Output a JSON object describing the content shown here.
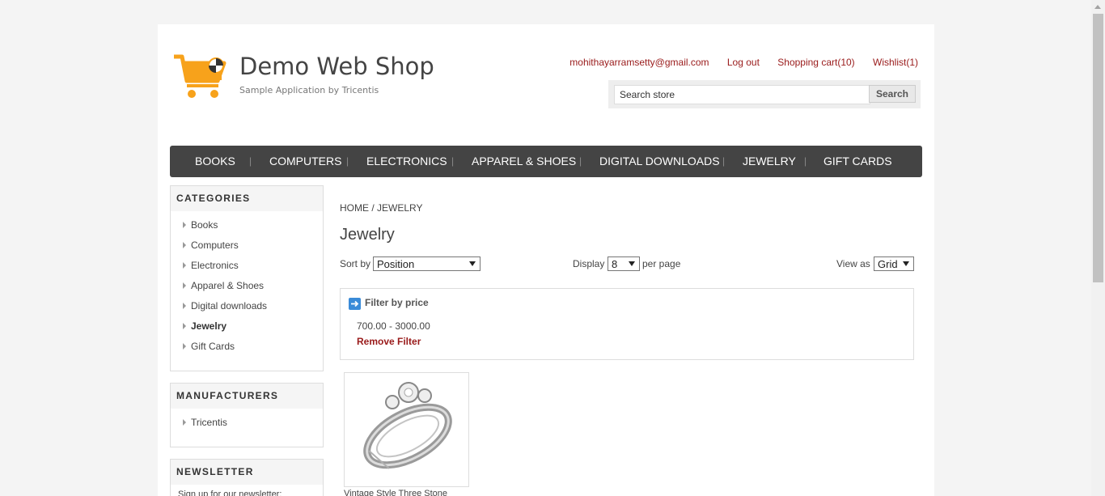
{
  "site": {
    "title": "Demo Web Shop",
    "subtitle": "Sample Application by Tricentis",
    "brand_color": "#f7a21b"
  },
  "header_links": {
    "account": "mohithayarramsetty@gmail.com",
    "logout": "Log out",
    "cart": "Shopping cart(10)",
    "wishlist": "Wishlist(1)"
  },
  "search": {
    "value": "Search store",
    "button": "Search"
  },
  "top_menu": [
    "BOOKS",
    "COMPUTERS",
    "ELECTRONICS",
    "APPAREL & SHOES",
    "DIGITAL DOWNLOADS",
    "JEWELRY",
    "GIFT CARDS"
  ],
  "categories": {
    "title": "CATEGORIES",
    "items": [
      "Books",
      "Computers",
      "Electronics",
      "Apparel & Shoes",
      "Digital downloads",
      "Jewelry",
      "Gift Cards"
    ],
    "active": "Jewelry"
  },
  "manufacturers": {
    "title": "MANUFACTURERS",
    "items": [
      "Tricentis"
    ]
  },
  "newsletter": {
    "title": "NEWSLETTER",
    "text": "Sign up for our newsletter:"
  },
  "breadcrumb": {
    "home": "HOME",
    "separator": "/",
    "current": "JEWELRY"
  },
  "page_title": "Jewelry",
  "controls": {
    "sort_label": "Sort by",
    "sort_value": "Position",
    "display_label": "Display",
    "display_value": "8",
    "per_page": "per page",
    "view_label": "View as",
    "view_value": "Grid"
  },
  "filter": {
    "title": "Filter by price",
    "range": "700.00 - 3000.00",
    "remove": "Remove Filter"
  },
  "product": {
    "title": "Vintage Style Three Stone"
  }
}
